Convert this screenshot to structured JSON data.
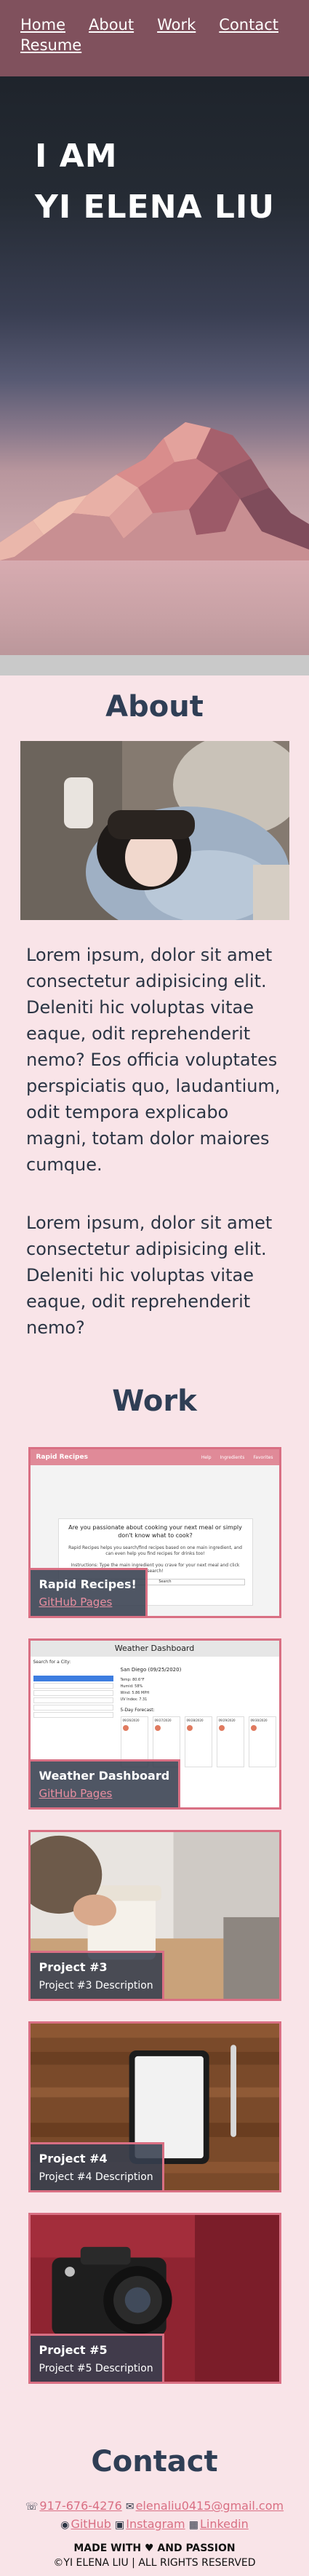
{
  "nav": {
    "items": [
      {
        "label": "Home"
      },
      {
        "label": "About"
      },
      {
        "label": "Work"
      },
      {
        "label": "Contact"
      },
      {
        "label": "Resume"
      }
    ]
  },
  "hero": {
    "line1": "I AM",
    "line2": "YI ELENA LIU"
  },
  "about": {
    "title": "About",
    "paragraph1": "Lorem ipsum, dolor sit amet consectetur adipisicing elit. Deleniti hic voluptas vitae eaque, odit reprehenderit nemo? Eos officia voluptates perspiciatis quo, laudantium, odit tempora explicabo magni, totam dolor maiores cumque.",
    "paragraph2": "Lorem ipsum, dolor sit amet consectetur adipisicing elit. Deleniti hic voluptas vitae eaque, odit reprehenderit nemo?"
  },
  "work": {
    "title": "Work",
    "projects": [
      {
        "name": "Rapid Recipes!",
        "link": "GitHub Pages",
        "screenshot": {
          "app_title": "Rapid Recipes",
          "nav": [
            "Help",
            "Ingredients",
            "Favorites"
          ],
          "question": "Are you passionate about cooking your next meal or simply don't know what to cook?",
          "blurb": "Rapid Recipes helps you search/find recipes based on one main ingredient, and can even help you find recipes for drinks too!",
          "instruction": "Instructions: Type the main ingredient you crave for your next meal and click search!",
          "search": "Search"
        }
      },
      {
        "name": "Weather Dashboard",
        "link": "GitHub Pages",
        "screenshot": {
          "app_title": "Weather Dashboard",
          "search_label": "Search for a City:",
          "city_header": "San Diego (09/25/2020)",
          "stats": [
            "Temp: 80.6°F",
            "Humid: 58%",
            "Wind: 5.86 MPH",
            "UV Index: 7.31"
          ],
          "forecast_title": "5-Day Forecast:",
          "forecast_dates": [
            "09/26/2020",
            "09/27/2020",
            "09/28/2020",
            "09/29/2020",
            "09/30/2020"
          ]
        }
      },
      {
        "name": "Project #3",
        "desc": "Project #3 Description"
      },
      {
        "name": "Project #4",
        "desc": "Project #4 Description"
      },
      {
        "name": "Project #5",
        "desc": "Project #5 Description"
      }
    ]
  },
  "contact": {
    "title": "Contact",
    "phone": "917-676-4276",
    "email": "elenaliu0415@gmail.com",
    "github": "GitHub",
    "instagram": "Instagram",
    "linkedin": "Linkedin",
    "made_with_before": "MADE WITH",
    "made_with_after": "AND PASSION",
    "rights": "©YI ELENA LIU | ALL RIGHTS RESERVED"
  },
  "colors": {
    "nav_bg": "#80515d",
    "page_bg": "#f9e4e8",
    "accent": "#d96f83",
    "heading": "#2f3e55",
    "label_bg": "#373f4e"
  },
  "icons": {
    "phone": "phone-icon",
    "email": "envelope-icon",
    "github": "github-icon",
    "instagram": "instagram-icon",
    "linkedin": "linkedin-icon",
    "heart": "heart-icon"
  }
}
